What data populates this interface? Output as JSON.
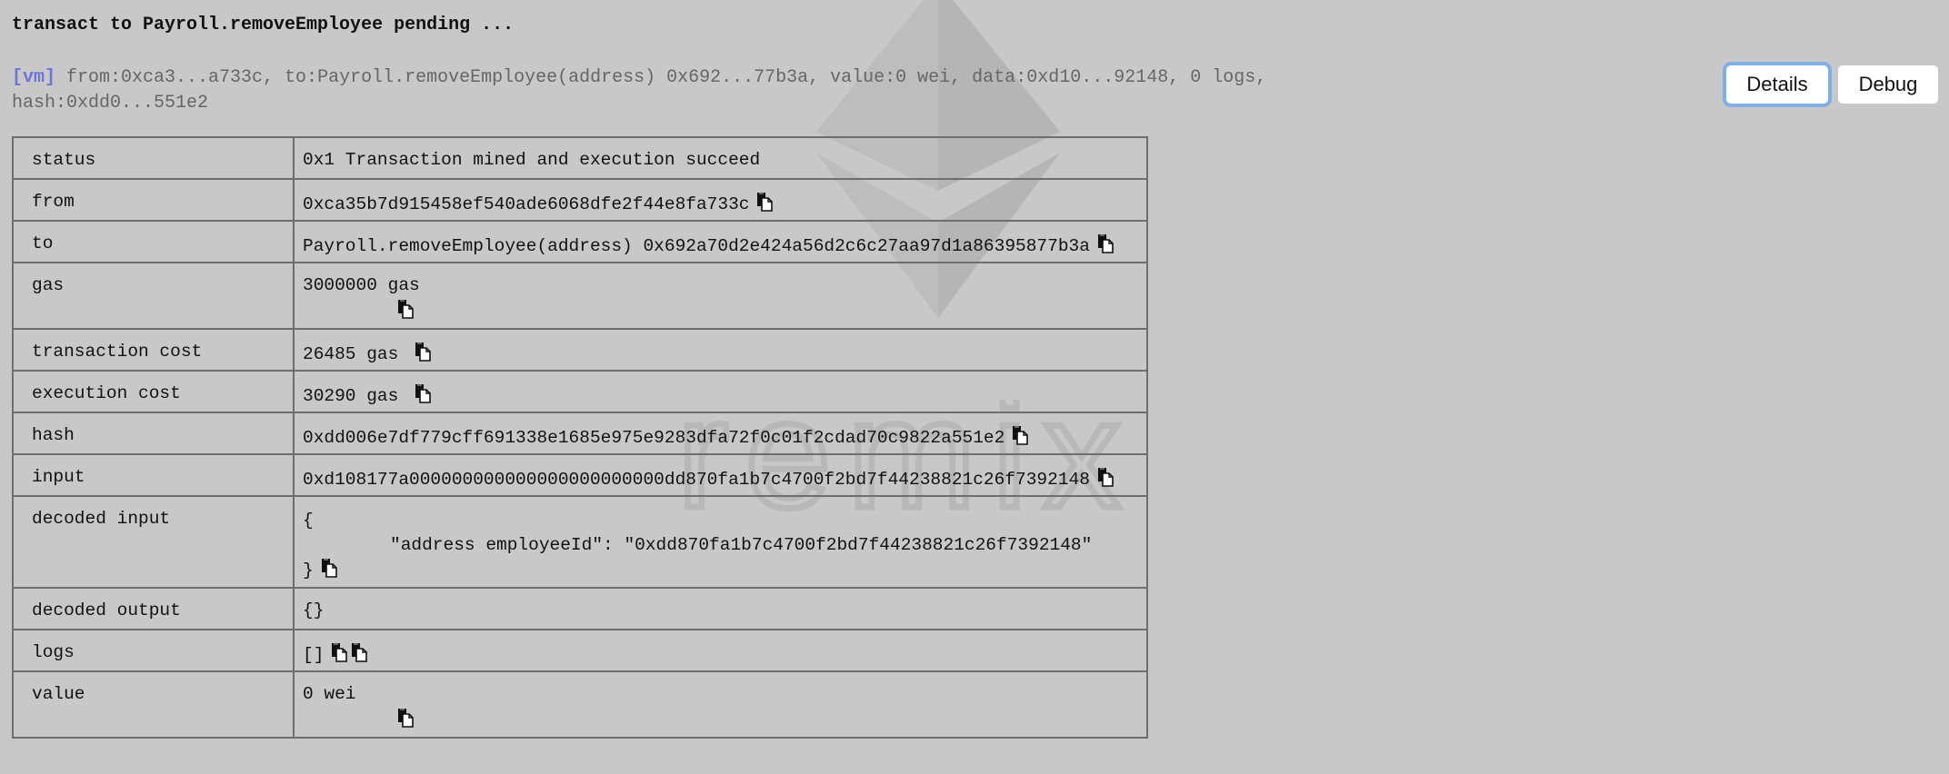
{
  "header": {
    "title": "transact to Payroll.removeEmployee pending ..."
  },
  "log": {
    "tag": "[vm]",
    "text": " from:0xca3...a733c, to:Payroll.removeEmployee(address) 0x692...77b3a, value:0 wei, data:0xd10...92148, 0 logs, hash:0xdd0...551e2"
  },
  "buttons": {
    "details": "Details",
    "debug": "Debug"
  },
  "watermark": {
    "text": "remix"
  },
  "rows": {
    "status": {
      "label": "status",
      "value": "0x1 Transaction mined and execution succeed"
    },
    "from": {
      "label": "from",
      "value": "0xca35b7d915458ef540ade6068dfe2f44e8fa733c"
    },
    "to": {
      "label": "to",
      "value": "Payroll.removeEmployee(address) 0x692a70d2e424a56d2c6c27aa97d1a86395877b3a"
    },
    "gas": {
      "label": "gas",
      "value": "3000000 gas"
    },
    "transaction_cost": {
      "label": "transaction cost",
      "value": "26485 gas"
    },
    "execution_cost": {
      "label": "execution cost",
      "value": "30290 gas"
    },
    "hash": {
      "label": "hash",
      "value": "0xdd006e7df779cff691338e1685e975e9283dfa72f0c01f2cdad70c9822a551e2"
    },
    "input": {
      "label": "input",
      "value": "0xd108177a000000000000000000000000dd870fa1b7c4700f2bd7f44238821c26f7392148"
    },
    "decoded_input": {
      "label": "decoded input",
      "open": "{",
      "line": "\"address employeeId\": \"0xdd870fa1b7c4700f2bd7f44238821c26f7392148\"",
      "close": "}"
    },
    "decoded_output": {
      "label": "decoded output",
      "value": "{}"
    },
    "logs": {
      "label": "logs",
      "value": "[]"
    },
    "value": {
      "label": "value",
      "value": "0 wei"
    }
  },
  "colors": {
    "background": "#c8c8c8",
    "vm_tag": "#6f73d8",
    "focus_ring": "#80aee6",
    "border": "#6e6e6e"
  }
}
